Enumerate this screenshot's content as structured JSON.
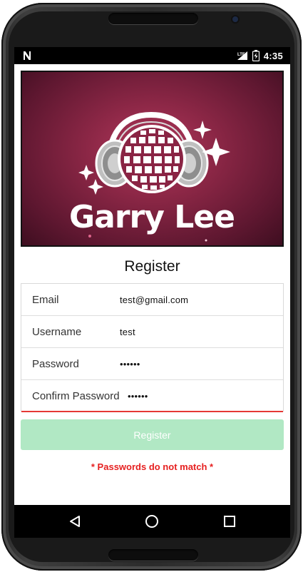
{
  "status_bar": {
    "time": "4:35",
    "left_icon": "n-notification-icon",
    "right_icons": [
      "lte-signal-icon",
      "battery-charging-icon"
    ]
  },
  "banner": {
    "logo_text": "Garry Lee"
  },
  "form": {
    "title": "Register",
    "fields": [
      {
        "label": "Email",
        "value": "test@gmail.com"
      },
      {
        "label": "Username",
        "value": "test"
      },
      {
        "label": "Password",
        "value": "••••••"
      },
      {
        "label": "Confirm Password",
        "value": "••••••"
      }
    ],
    "submit_label": "Register",
    "error_message": "* Passwords do not match *"
  },
  "colors": {
    "accent_button": "#b1e8c4",
    "error": "#e62020",
    "active_underline": "#e53935",
    "banner_bg": "#8c2746"
  },
  "nav_bar": {
    "icons": [
      "back-icon",
      "home-icon",
      "recents-icon"
    ]
  }
}
